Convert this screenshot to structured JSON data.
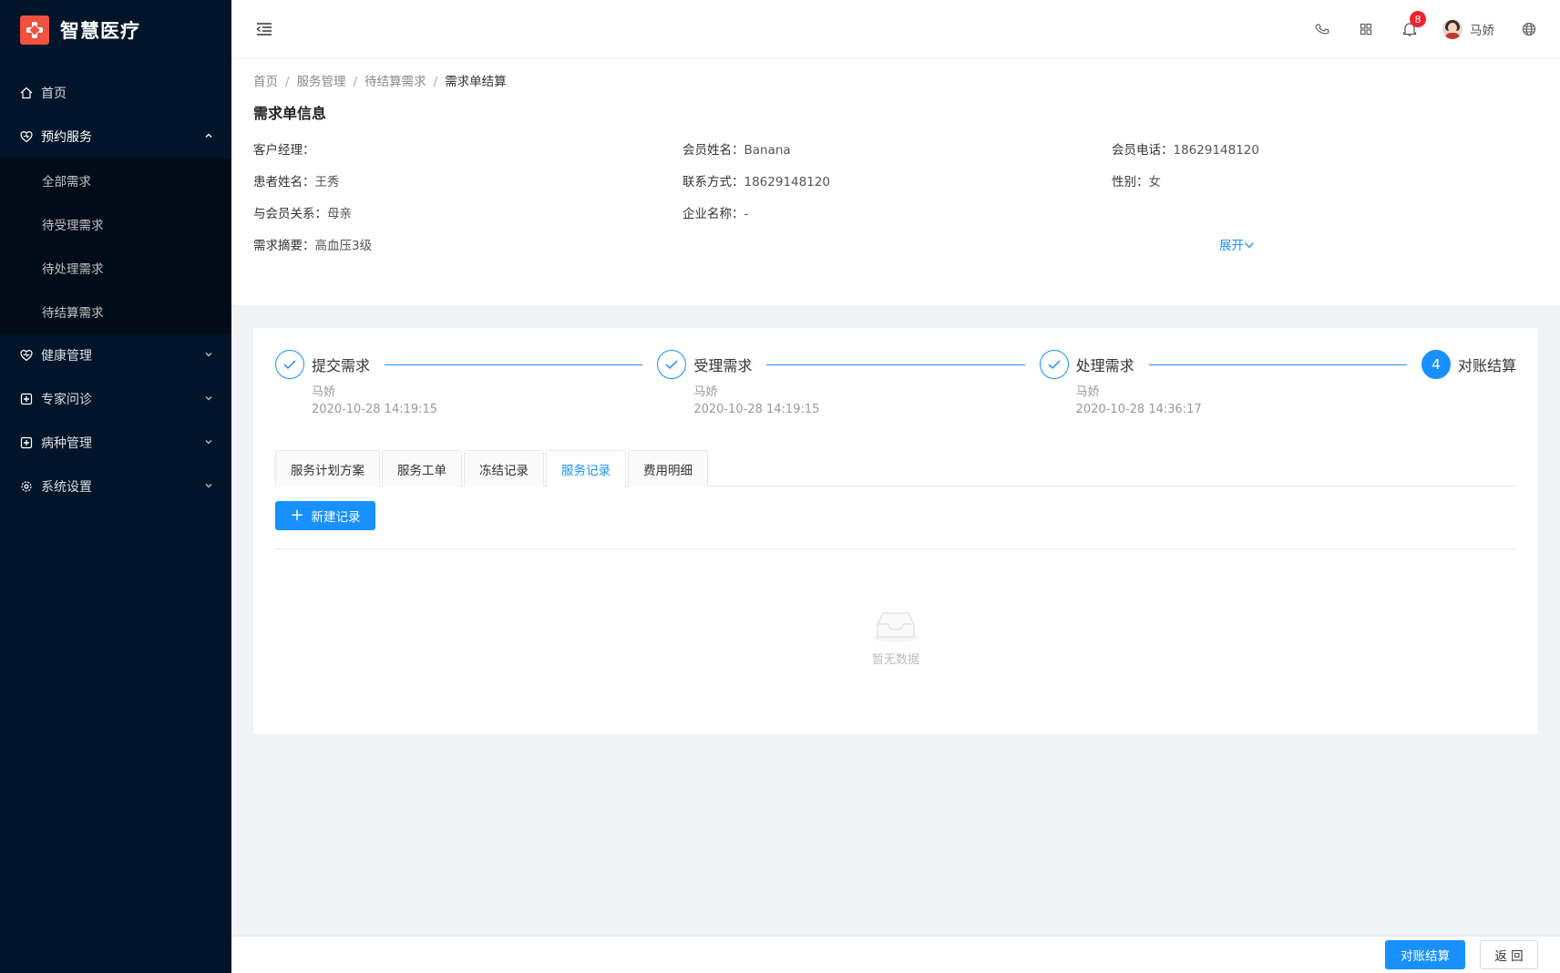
{
  "app": {
    "title": "智慧医疗"
  },
  "sidebar": {
    "items": [
      {
        "label": "首页",
        "icon": "home-icon"
      },
      {
        "label": "预约服务",
        "icon": "heart-shield-icon",
        "open": true,
        "children": [
          "全部需求",
          "待受理需求",
          "待处理需求",
          "待结算需求"
        ]
      },
      {
        "label": "健康管理",
        "icon": "heart-pulse-icon"
      },
      {
        "label": "专家问诊",
        "icon": "medical-plus-icon"
      },
      {
        "label": "病种管理",
        "icon": "medical-plus-icon"
      },
      {
        "label": "系统设置",
        "icon": "gear-icon"
      }
    ]
  },
  "header": {
    "badge_count": "8",
    "user_name": "马娇",
    "icons": [
      "phone-icon",
      "grid-icon",
      "bell-icon",
      "globe-icon"
    ]
  },
  "breadcrumb": [
    "首页",
    "服务管理",
    "待结算需求",
    "需求单结算"
  ],
  "info": {
    "title": "需求单信息",
    "rows": [
      [
        {
          "label": "客户经理：",
          "value": ""
        },
        {
          "label": "会员姓名：",
          "value": "Banana"
        },
        {
          "label": "会员电话：",
          "value": "18629148120"
        }
      ],
      [
        {
          "label": "患者姓名：",
          "value": "王秀"
        },
        {
          "label": "联系方式：",
          "value": "18629148120"
        },
        {
          "label": "性别：",
          "value": "女"
        }
      ],
      [
        {
          "label": "与会员关系：",
          "value": "母亲"
        },
        {
          "label": "企业名称：",
          "value": "-"
        }
      ],
      [
        {
          "label": "需求摘要：",
          "value": "高血压3级"
        }
      ]
    ],
    "expand_label": "展开"
  },
  "steps": [
    {
      "title": "提交需求",
      "person": "马娇",
      "time": "2020-10-28 14:19:15",
      "status": "finished"
    },
    {
      "title": "受理需求",
      "person": "马娇",
      "time": "2020-10-28 14:19:15",
      "status": "finished"
    },
    {
      "title": "处理需求",
      "person": "马娇",
      "time": "2020-10-28 14:36:17",
      "status": "finished"
    },
    {
      "title": "对账结算",
      "number": "4",
      "status": "active"
    }
  ],
  "tabs": [
    "服务计划方案",
    "服务工单",
    "冻结记录",
    "服务记录",
    "费用明细"
  ],
  "active_tab": "服务记录",
  "new_record_label": "新建记录",
  "empty_text": "暂无数据",
  "footer": {
    "confirm_label": "对账结算",
    "back_label": "返 回"
  },
  "colors": {
    "primary": "#1890ff",
    "sidebar_bg": "#001529",
    "logo": "#f0523f",
    "badge": "#f5222d"
  }
}
